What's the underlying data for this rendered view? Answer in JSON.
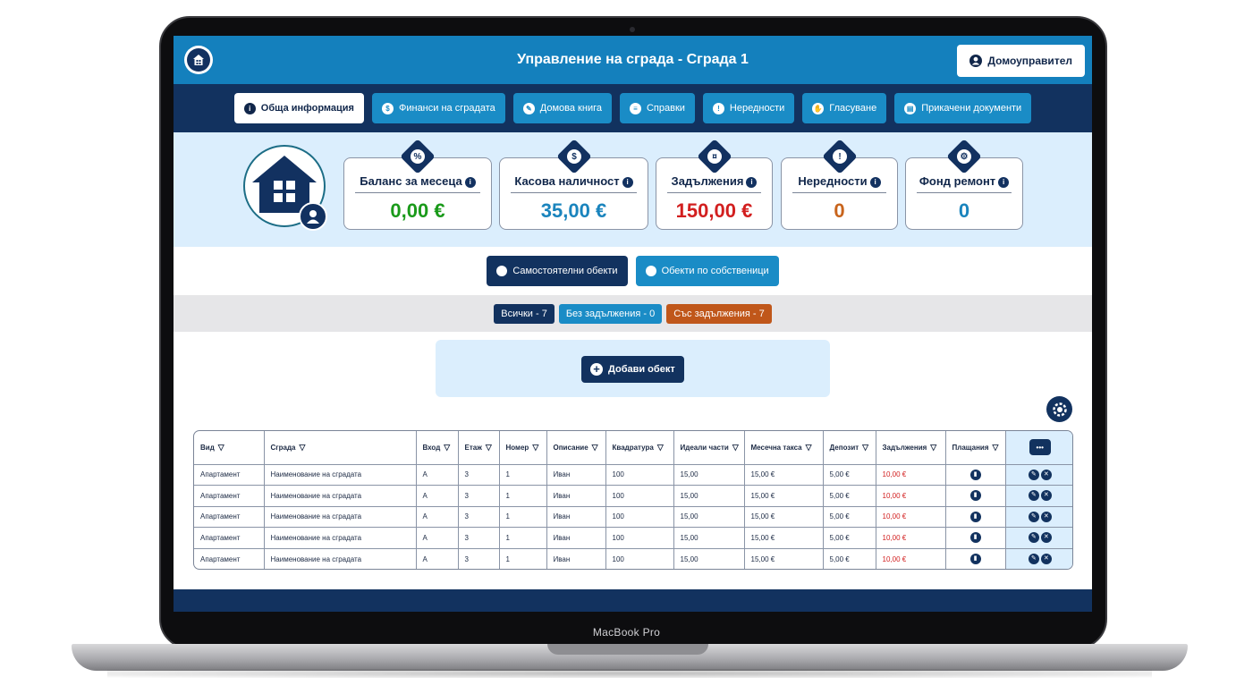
{
  "device": {
    "brand_label": "MacBook Pro"
  },
  "header": {
    "title": "Управление на сграда - Сграда 1",
    "user_button": "Домоуправител"
  },
  "nav": {
    "tabs": [
      {
        "label": "Обща информация",
        "icon": "info-icon",
        "glyph": "i"
      },
      {
        "label": "Финанси на сградата",
        "icon": "dollar-icon",
        "glyph": "$"
      },
      {
        "label": "Домова книга",
        "icon": "book-icon",
        "glyph": "✎"
      },
      {
        "label": "Справки",
        "icon": "report-icon",
        "glyph": "≡"
      },
      {
        "label": "Нередности",
        "icon": "warning-icon",
        "glyph": "!"
      },
      {
        "label": "Гласуване",
        "icon": "vote-hand-icon",
        "glyph": "✋"
      },
      {
        "label": "Прикачени документи",
        "icon": "document-icon",
        "glyph": "▤"
      }
    ]
  },
  "stats": [
    {
      "label": "Баланс за месеца",
      "value": "0,00 €",
      "color": "#1a9a1a",
      "badge": "%",
      "icon": "percent-icon"
    },
    {
      "label": "Касова наличност",
      "value": "35,00 €",
      "color": "#1a84bd",
      "badge": "$",
      "icon": "dollar-icon"
    },
    {
      "label": "Задължения",
      "value": "150,00 €",
      "color": "#d21f1f",
      "badge": "¤",
      "icon": "coins-icon"
    },
    {
      "label": "Нередности",
      "value": "0",
      "color": "#c8641c",
      "badge": "!",
      "icon": "warning-icon"
    },
    {
      "label": "Фонд ремонт",
      "value": "0",
      "color": "#1a84bd",
      "badge": "⚙",
      "icon": "repair-gear-icon"
    }
  ],
  "view_switch": {
    "own_objects": "Самостоятелни обекти",
    "by_owner": "Обекти по собственици"
  },
  "filters": [
    {
      "label": "Всички - 7",
      "color": "#12325f"
    },
    {
      "label": "Без задължения - 0",
      "color": "#1a8cc6"
    },
    {
      "label": "Със задължения - 7",
      "color": "#c0571a"
    }
  ],
  "add_object_label": "Добави обект",
  "table": {
    "columns": [
      "Вид",
      "Сграда",
      "Вход",
      "Етаж",
      "Номер",
      "Описание",
      "Квадратура",
      "Идеали части",
      "Месечна такса",
      "Депозит",
      "Задължения",
      "Плащания"
    ],
    "rows": [
      [
        "Апартамент",
        "Наименование на сградата",
        "А",
        "3",
        "1",
        "Иван",
        "100",
        "15,00",
        "15,00 €",
        "5,00 €",
        "10,00 €"
      ],
      [
        "Апартамент",
        "Наименование на сградата",
        "А",
        "3",
        "1",
        "Иван",
        "100",
        "15,00",
        "15,00 €",
        "5,00 €",
        "10,00 €"
      ],
      [
        "Апартамент",
        "Наименование на сградата",
        "А",
        "3",
        "1",
        "Иван",
        "100",
        "15,00",
        "15,00 €",
        "5,00 €",
        "10,00 €"
      ],
      [
        "Апартамент",
        "Наименование на сградата",
        "А",
        "3",
        "1",
        "Иван",
        "100",
        "15,00",
        "15,00 €",
        "5,00 €",
        "10,00 €"
      ],
      [
        "Апартамент",
        "Наименование на сградата",
        "А",
        "3",
        "1",
        "Иван",
        "100",
        "15,00",
        "15,00 €",
        "5,00 €",
        "10,00 €"
      ]
    ]
  },
  "colors": {
    "primary": "#1480bd",
    "navy": "#12325f",
    "light_panel": "#dbeefd",
    "debt": "#d21f1f"
  }
}
